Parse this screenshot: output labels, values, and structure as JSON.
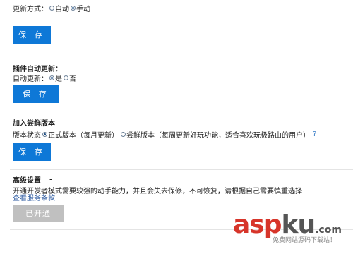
{
  "update_method": {
    "label": "更新方式：",
    "options": [
      "自动",
      "手动"
    ],
    "selected": "手动",
    "save_label": "保 存"
  },
  "plugin_autoupdate": {
    "title": "插件自动更新：",
    "label": "自动更新：",
    "options": [
      "是",
      "否"
    ],
    "selected": "是",
    "save_label": "保 存"
  },
  "early_access": {
    "title": "加入尝鲜版本",
    "label": "版本状态",
    "options": [
      "正式版本（每月更新）",
      "尝鲜版本（每周更新好玩功能，适合喜欢玩极路由的用户）"
    ],
    "selected": "正式版本（每月更新）",
    "help_symbol": "?",
    "save_label": "保 存"
  },
  "advanced": {
    "title": "高级设置",
    "title_dash": "-",
    "description": "开通开发者模式需要较强的动手能力，并且会失去保修，不可恢复，请根据自己需要慎重选择",
    "terms_link": "查看服务条款",
    "activated_label": "已开通"
  },
  "watermark": {
    "asp": "asp",
    "ku": "ku",
    "com": ".com",
    "tagline": "免费网站源码下载站！"
  },
  "colors": {
    "primary_button": "#0e78d7",
    "disabled_button": "#c0c0c0",
    "accent_line": "#b8342c",
    "link": "#2c5aa0"
  }
}
